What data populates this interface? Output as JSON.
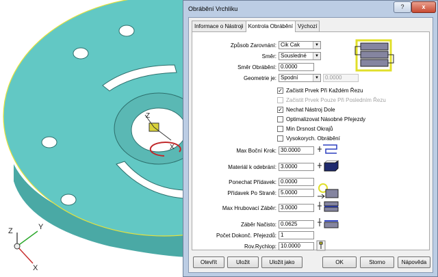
{
  "dialog": {
    "title": "Obrábění Vrchlíku",
    "close_glyph": "x",
    "help_glyph": "?"
  },
  "tabs": [
    {
      "label": "Informace o Nástroji",
      "active": false
    },
    {
      "label": "Kontrola Obrábění",
      "active": true
    },
    {
      "label": "Výchozí",
      "active": false
    }
  ],
  "form": {
    "zarovnani": {
      "label": "Způsob Zarovnání:",
      "value": "Cik Cak"
    },
    "smer": {
      "label": "Směr:",
      "value": "Sousledné"
    },
    "smer_obrabeni": {
      "label": "Směr Obrábění:",
      "value": "0.0000"
    },
    "geometrie": {
      "label": "Geometrie je:",
      "value": "Spodní",
      "extra_value": "0.0000"
    },
    "checkboxes": [
      {
        "label": "Začistit Prvek Při Každém Řezu",
        "checked": true,
        "disabled": false
      },
      {
        "label": "Začistit Prvek Pouze Při Posledním Řezu",
        "checked": false,
        "disabled": true
      },
      {
        "label": "Nechat Nástroj Dole",
        "checked": true,
        "disabled": false
      },
      {
        "label": "Optimalizovat Násobné Přejezdy",
        "checked": false,
        "disabled": false
      },
      {
        "label": "Min Drsnost Okrajů",
        "checked": false,
        "disabled": false
      },
      {
        "label": "Vysokorych. Obrábění",
        "checked": false,
        "disabled": false
      }
    ],
    "max_bocni_krok": {
      "label": "Max Boční Krok:",
      "value": "30.0000"
    },
    "material_k_odebrani": {
      "label": "Materiál k odebrání:",
      "value": "3.0000"
    },
    "ponechat_pridavek": {
      "label": "Ponechat Přídavek:",
      "value": "0.0000"
    },
    "pridavek_po_strane": {
      "label": "Přídavek Po Straně:",
      "value": "5.0000"
    },
    "max_hrubovaci_zaber": {
      "label": "Max Hrubovací Záběr:",
      "value": "3.0000"
    },
    "zaber_nacisto": {
      "label": "Záběr Načisto:",
      "value": "0.0625"
    },
    "pocet_dokonc": {
      "label": "Počet Dokonč. Přejezdů:",
      "value": "1"
    },
    "rov_rychlop": {
      "label": "Rov.Rychlop:",
      "value": "10.0000"
    }
  },
  "checkmark": "✓",
  "buttons": {
    "otevrit": "Otevřít",
    "ulozit": "Uložit",
    "ulozit_jako": "Uložit jako",
    "ok": "OK",
    "storno": "Storno",
    "napoveda": "Nápověda"
  },
  "viewport": {
    "axis_labels": {
      "x": "X",
      "y": "Y",
      "z": "Z"
    },
    "part_color": "#62c8c4",
    "edge_color": "#e6e23c"
  }
}
